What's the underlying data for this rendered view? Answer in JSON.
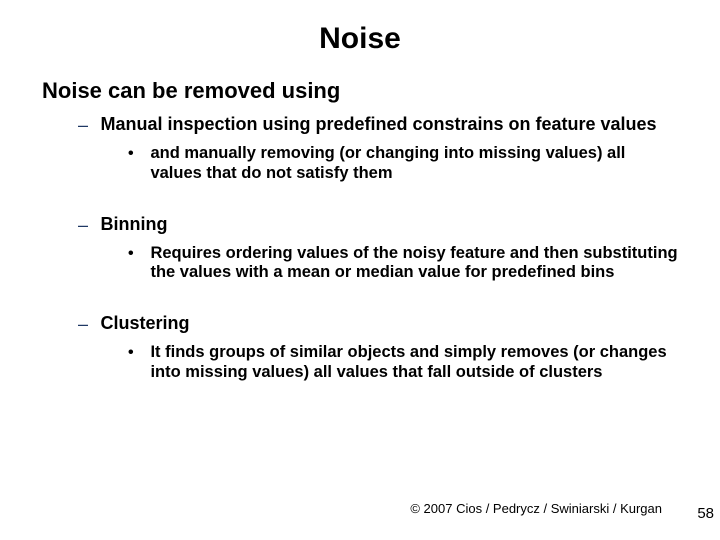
{
  "title": "Noise",
  "intro": "Noise can be removed using",
  "methods": [
    {
      "title": "Manual inspection using predefined constrains on feature values",
      "sub": "and manually removing (or changing into missing values) all values that do not satisfy them"
    },
    {
      "title": "Binning",
      "sub": "Requires ordering values of the noisy feature and then substituting the values with a mean or median value for predefined bins"
    },
    {
      "title": "Clustering",
      "sub": "It finds groups of similar objects and simply removes (or changes into missing values) all values that fall outside of clusters"
    }
  ],
  "footer": "© 2007 Cios / Pedrycz / Swiniarski / Kurgan",
  "page": "58"
}
